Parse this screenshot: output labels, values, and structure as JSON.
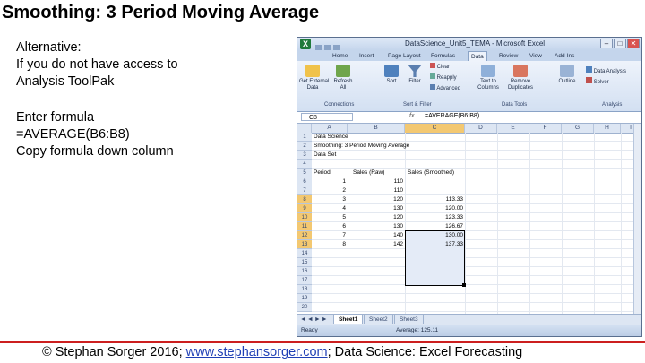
{
  "slide": {
    "title": "Smoothing: 3 Period Moving Average",
    "notes": {
      "line1": "Alternative:",
      "line2": "If you do not have access to",
      "line3": "Analysis ToolPak",
      "line4": "Enter formula",
      "line5": "=AVERAGE(B6:B8)",
      "line6": "Copy formula down column"
    },
    "footer": {
      "prefix": "© Stephan Sorger 2016; ",
      "link": "www.stephansorger.com",
      "suffix": "; Data Science: Excel Forecasting"
    }
  },
  "excel": {
    "window_title": "DataScience_Unit5_TEMA - Microsoft Excel",
    "logo": "X",
    "window_buttons": [
      "–",
      "□",
      "✕"
    ],
    "tabs": [
      "Home",
      "Insert",
      "Page Layout",
      "Formulas",
      "Data",
      "Review",
      "View",
      "Add-Ins"
    ],
    "active_tab": "Data",
    "ribbon": {
      "buttons": [
        {
          "label": "Get External\nData",
          "icon": "database-icon"
        },
        {
          "label": "Refresh\nAll",
          "icon": "refresh-icon"
        },
        {
          "label": "Sort",
          "icon": "sort-icon"
        },
        {
          "label": "Filter",
          "icon": "filter-icon"
        },
        {
          "label": "Clear",
          "icon": "clear-icon"
        },
        {
          "label": "Reapply",
          "icon": "reapply-icon"
        },
        {
          "label": "Advanced",
          "icon": "advanced-filter-icon"
        },
        {
          "label": "Text to\nColumns",
          "icon": "text-to-columns-icon"
        },
        {
          "label": "Remove\nDuplicates",
          "icon": "remove-duplicates-icon"
        },
        {
          "label": "Outline",
          "icon": "outline-icon"
        },
        {
          "label": "Data Analysis",
          "icon": "data-analysis-icon"
        },
        {
          "label": "Solver",
          "icon": "solver-icon"
        }
      ],
      "groups": [
        "Connections",
        "Sort & Filter",
        "Data Tools",
        "Analysis"
      ]
    },
    "name_box": "C8",
    "fx_label": "fx",
    "formula": "=AVERAGE(B6:B8)",
    "columns": [
      "A",
      "B",
      "C",
      "D",
      "E",
      "F",
      "G",
      "H",
      "I"
    ],
    "selected_column": "C",
    "row_numbers": [
      "1",
      "2",
      "3",
      "4",
      "5",
      "6",
      "7",
      "8",
      "9",
      "10",
      "11",
      "12",
      "13",
      "14",
      "15",
      "16",
      "17",
      "18",
      "19",
      "20"
    ],
    "selected_rows": [
      "8",
      "9",
      "10",
      "11",
      "12",
      "13"
    ],
    "header_lines": [
      "Data Science",
      "Smoothing: 3 Period Moving Average",
      "Data Set"
    ],
    "table_headers": [
      "Period",
      "Sales (Raw)",
      "Sales (Smoothed)"
    ],
    "table_rows": [
      {
        "period": "1",
        "raw": "110",
        "smoothed": ""
      },
      {
        "period": "2",
        "raw": "110",
        "smoothed": ""
      },
      {
        "period": "3",
        "raw": "120",
        "smoothed": "113.33"
      },
      {
        "period": "4",
        "raw": "130",
        "smoothed": "120.00"
      },
      {
        "period": "5",
        "raw": "120",
        "smoothed": "123.33"
      },
      {
        "period": "6",
        "raw": "130",
        "smoothed": "126.67"
      },
      {
        "period": "7",
        "raw": "140",
        "smoothed": "130.00"
      },
      {
        "period": "8",
        "raw": "142",
        "smoothed": "137.33"
      }
    ],
    "sheet_tabs": [
      "Sheet1",
      "Sheet2",
      "Sheet3"
    ],
    "active_sheet": "Sheet1",
    "status": {
      "mode": "Ready",
      "summary": "Average: 125.11"
    }
  }
}
